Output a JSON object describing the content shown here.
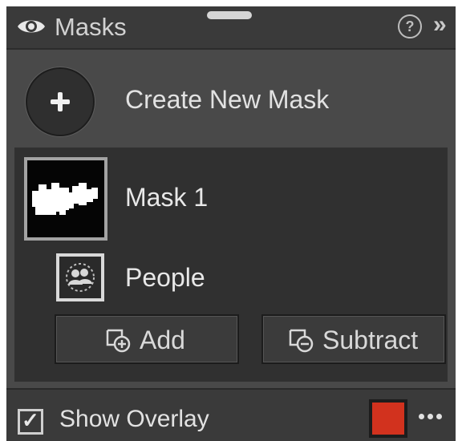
{
  "header": {
    "title": "Masks",
    "help_label": "?",
    "collapse_glyph": "»",
    "icons": [
      "eye-icon",
      "help-icon",
      "collapse-icon",
      "drag-handle"
    ]
  },
  "create": {
    "label": "Create New Mask",
    "icon": "plus-icon"
  },
  "mask": {
    "name": "Mask 1",
    "thumbnail_icon": "mask-thumbnail",
    "component": {
      "name": "People",
      "icon": "people-icon"
    },
    "actions": {
      "add_label": "Add",
      "subtract_label": "Subtract",
      "add_icon": "add-mask-icon",
      "subtract_icon": "subtract-mask-icon"
    }
  },
  "footer": {
    "overlay_label": "Show Overlay",
    "overlay_checked": true,
    "overlay_color": "#d2321e",
    "more_icon": "more-icon"
  },
  "colors": {
    "panel_bg": "#494949",
    "header_bg": "#3a3a3a",
    "mask_area_bg": "#303030",
    "text": "#e2e2e2"
  }
}
